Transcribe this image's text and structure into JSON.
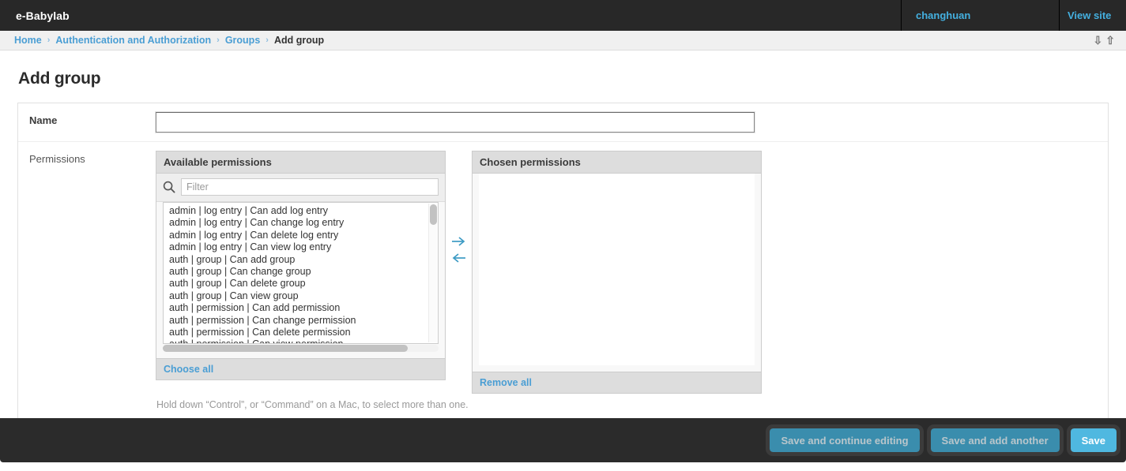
{
  "header": {
    "site_name": "e-Babylab",
    "username": "changhuan",
    "view_site_label": "View site"
  },
  "breadcrumbs": {
    "items": [
      {
        "label": "Home",
        "link": true
      },
      {
        "label": "Authentication and Authorization",
        "link": true
      },
      {
        "label": "Groups",
        "link": true
      },
      {
        "label": "Add group",
        "link": false
      }
    ],
    "separator": "›",
    "collapse_all_icon": "chevron-double-down-icon",
    "expand_all_icon": "chevron-double-up-icon"
  },
  "page": {
    "title": "Add group"
  },
  "form": {
    "name_row": {
      "label": "Name",
      "value": "",
      "placeholder": ""
    },
    "permissions_row": {
      "label": "Permissions",
      "help_text": "Hold down “Control”, or “Command” on a Mac, to select more than one."
    }
  },
  "selector": {
    "available": {
      "title": "Available permissions",
      "filter_placeholder": "Filter",
      "filter_value": "",
      "search_icon": "search-icon",
      "choose_all_label": "Choose all",
      "options": [
        "admin | log entry | Can add log entry",
        "admin | log entry | Can change log entry",
        "admin | log entry | Can delete log entry",
        "admin | log entry | Can view log entry",
        "auth | group | Can add group",
        "auth | group | Can change group",
        "auth | group | Can delete group",
        "auth | group | Can view group",
        "auth | permission | Can add permission",
        "auth | permission | Can change permission",
        "auth | permission | Can delete permission",
        "auth | permission | Can view permission"
      ]
    },
    "chosen": {
      "title": "Chosen permissions",
      "remove_all_label": "Remove all",
      "options": []
    },
    "add_arrow_icon": "arrow-right-icon",
    "remove_arrow_icon": "arrow-left-icon"
  },
  "submit_row": {
    "save_and_continue_label": "Save and continue editing",
    "save_and_add_another_label": "Save and add another",
    "save_label": "Save"
  },
  "colors": {
    "accent": "#4a9ed4",
    "header_bg": "#282828",
    "footer_bg": "#2b2b2b",
    "primary_button": "#4fb8e0",
    "muted_button": "#3a8dad",
    "link": "#44b0e0"
  }
}
